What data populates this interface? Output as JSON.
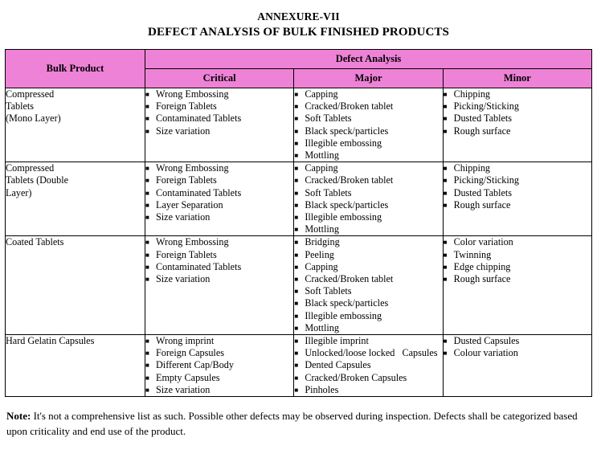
{
  "document": {
    "title_top": "ANNEXURE-VII",
    "title_main": "DEFECT ANALYSIS OF BULK FINISHED PRODUCTS"
  },
  "colors": {
    "header_background": "#EE82D6",
    "border": "#000000",
    "text": "#000000"
  },
  "table": {
    "headers": {
      "bulk_product": "Bulk Product",
      "defect_analysis": "Defect Analysis",
      "critical": "Critical",
      "major": "Major",
      "minor": "Minor"
    },
    "rows": [
      {
        "product": "Compressed\nTablets\n(Mono Layer)",
        "critical": [
          "Wrong Embossing",
          "Foreign Tablets",
          "Contaminated Tablets",
          "Size variation"
        ],
        "major": [
          "Capping",
          "Cracked/Broken tablet",
          "Soft Tablets",
          "Black speck/particles",
          "Illegible embossing",
          "Mottling"
        ],
        "minor": [
          "Chipping",
          "Picking/Sticking",
          "Dusted Tablets",
          "Rough surface"
        ]
      },
      {
        "product": "Compressed\nTablets (Double\nLayer)",
        "critical": [
          "Wrong Embossing",
          "Foreign Tablets",
          "Contaminated Tablets",
          "Layer Separation",
          "Size variation"
        ],
        "major": [
          "Capping",
          "Cracked/Broken tablet",
          "Soft Tablets",
          "Black speck/particles",
          "Illegible embossing",
          "Mottling"
        ],
        "minor": [
          "Chipping",
          "Picking/Sticking",
          "Dusted Tablets",
          "Rough surface"
        ]
      },
      {
        "product": "Coated Tablets",
        "critical": [
          "Wrong Embossing",
          "Foreign Tablets",
          "Contaminated Tablets",
          "Size variation"
        ],
        "major": [
          "Bridging",
          "Peeling",
          "Capping",
          "Cracked/Broken tablet",
          "Soft Tablets",
          "Black speck/particles",
          "Illegible embossing",
          "Mottling"
        ],
        "minor": [
          "Color variation",
          "Twinning",
          "Edge chipping",
          "Rough surface"
        ]
      },
      {
        "product": "Hard Gelatin Capsules",
        "critical": [
          "Wrong imprint",
          "Foreign Capsules",
          "Different Cap/Body",
          "Empty Capsules",
          "Size variation"
        ],
        "major": [
          "Illegible imprint",
          "Unlocked/loose locked   Capsules",
          "Dented Capsules",
          "Cracked/Broken Capsules",
          "Pinholes"
        ],
        "minor": [
          "Dusted Capsules",
          "Colour variation"
        ]
      }
    ]
  },
  "note": {
    "label": "Note:",
    "text": " It's not a comprehensive list as such. Possible other defects may be observed during inspection. Defects shall be categorized based upon criticality and end use of the product."
  },
  "icons": {
    "bullet": "■"
  }
}
